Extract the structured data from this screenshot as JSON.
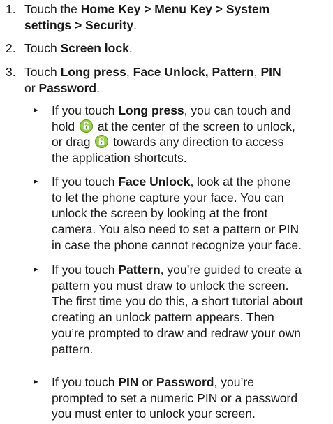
{
  "steps": [
    {
      "number": "1.",
      "line1_prefix": "Touch the ",
      "line1_bold": "Home Key > Menu Key > System",
      "line2_bold": "settings > Security",
      "line2_suffix": "."
    },
    {
      "number": "2.",
      "prefix": "Touch ",
      "bold": "Screen lock",
      "suffix": "."
    },
    {
      "number": "3.",
      "prefix": "Touch ",
      "opt1": "Long press",
      "sep1": ", ",
      "opt2": "Face Unlock, Pattern",
      "sep2": ", ",
      "opt3": "PIN",
      "line2_prefix": "or ",
      "opt4": "Password",
      "line2_suffix": "."
    }
  ],
  "bullets": {
    "marker": "►",
    "long_press": {
      "l1_prefix": "If you touch ",
      "l1_bold": "Long press",
      "l1_suffix": ", you can touch and",
      "l2_prefix": "hold ",
      "l2_suffix": " at the center of the screen to unlock,",
      "l3_prefix": "or drag ",
      "l3_suffix": " towards any direction to access",
      "l4": "the application shortcuts."
    },
    "face_unlock": {
      "l1_prefix": "If you touch ",
      "l1_bold": "Face Unlock",
      "l1_suffix": ", look at the phone",
      "l2": "to let the phone capture your face. You can",
      "l3": "unlock the screen by looking at the front",
      "l4": "camera. You also need to set a pattern or PIN",
      "l5": "in case the phone cannot recognize your face."
    },
    "pattern": {
      "l1_prefix": "If you touch ",
      "l1_bold": "Pattern",
      "l1_suffix": ", you’re guided to create a",
      "l2": "pattern you must draw to unlock the screen.",
      "l3": "The first time you do this, a short tutorial about",
      "l4": "creating an unlock pattern appears. Then",
      "l5": "you’re prompted to draw and redraw your own",
      "l6": "pattern."
    },
    "pin_password": {
      "l1_prefix": "If you touch ",
      "l1_bold1": "PIN",
      "l1_mid": " or ",
      "l1_bold2": "Password",
      "l1_suffix": ", you’re",
      "l2": "prompted to set a numeric PIN or a password",
      "l3": "you must enter to unlock your screen."
    }
  },
  "colors": {
    "text": "#1a1a1a",
    "lock_icon_fill": "#8cc63f",
    "lock_icon_dark": "#4f8a10"
  },
  "icons": {
    "unlock": "unlock-icon"
  }
}
